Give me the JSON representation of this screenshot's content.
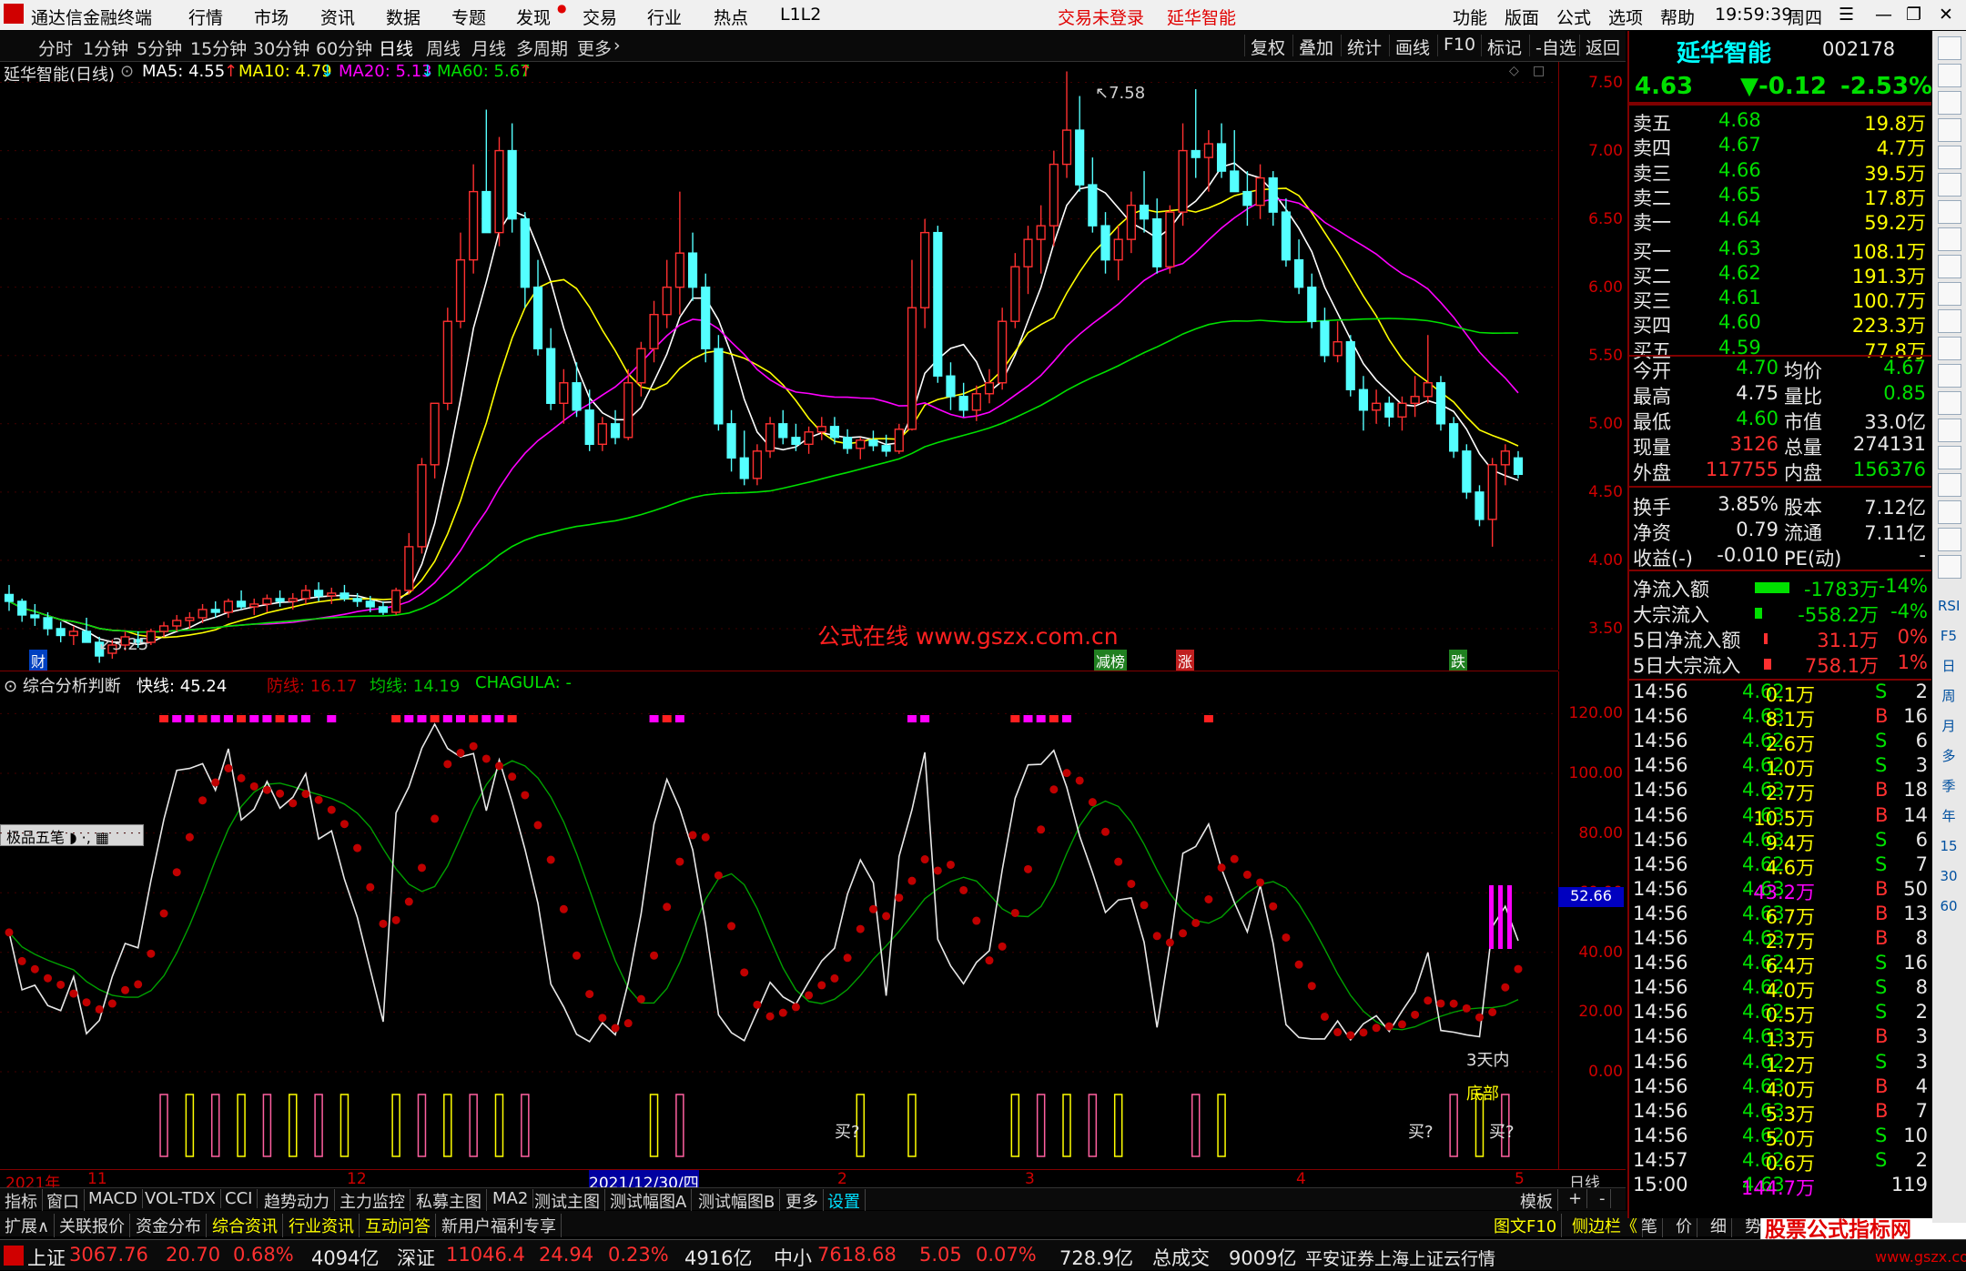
{
  "titlebar": {
    "app_name": "通达信金融终端",
    "menus": [
      "行情",
      "市场",
      "资讯",
      "数据",
      "专题",
      "发现",
      "交易",
      "行业",
      "热点",
      "L1L2"
    ],
    "status_trade": "交易未登录",
    "status_stock": "延华智能",
    "right_menus": [
      "功能",
      "版面",
      "公式",
      "选项",
      "帮助"
    ],
    "clock": "19:59:39",
    "weekday": "周四"
  },
  "periodbar": {
    "periods": [
      "分时",
      "1分钟",
      "5分钟",
      "15分钟",
      "30分钟",
      "60分钟",
      "日线",
      "周线",
      "月线",
      "多周期",
      "更多"
    ],
    "selected": "日线",
    "actions": [
      "复权",
      "叠加",
      "统计",
      "画线",
      "F10",
      "标记",
      "-自选",
      "返回"
    ]
  },
  "kline": {
    "title": "延华智能(日线)",
    "ma5": "MA5: 4.55",
    "ma10": "MA10: 4.79",
    "ma20": "MA20: 5.13",
    "ma60": "MA60: 5.67",
    "high_label": "7.58",
    "low_label": "3.25",
    "watermark": "公式在线  www.gszx.com.cn",
    "markers": [
      "财",
      "减榜",
      "涨",
      "跌"
    ],
    "y_ticks": [
      "7.50",
      "7.00",
      "6.50",
      "6.00",
      "5.50",
      "5.00",
      "4.50",
      "4.00",
      "3.50"
    ]
  },
  "indicator": {
    "title": "综合分析判断",
    "fast_label": "快线: 45.24",
    "defense_label": "防线: 16.17",
    "avg_label": "均线: 14.19",
    "chagula_label": "CHAGULA: -",
    "toolbar_label": "极品五笔",
    "current_value": "52.66",
    "y_ticks": [
      "120.00",
      "100.00",
      "80.00",
      "60.00",
      "40.00",
      "20.00",
      "0.00"
    ],
    "annotations": [
      "3天内",
      "底部",
      "买?",
      "买?",
      "买?"
    ]
  },
  "xaxis": {
    "labels": [
      "2021年",
      "11",
      "12",
      "2021/12/30/四",
      "2",
      "3",
      "4",
      "5"
    ],
    "period": "日线"
  },
  "quote": {
    "name": "延华智能",
    "code": "002178",
    "price": "4.63",
    "change": "▼-0.12",
    "change_pct": "-2.53%",
    "asks": [
      {
        "label": "卖五",
        "price": "4.68",
        "vol": "19.8万"
      },
      {
        "label": "卖四",
        "price": "4.67",
        "vol": "4.7万"
      },
      {
        "label": "卖三",
        "price": "4.66",
        "vol": "39.5万"
      },
      {
        "label": "卖二",
        "price": "4.65",
        "vol": "17.8万"
      },
      {
        "label": "卖一",
        "price": "4.64",
        "vol": "59.2万"
      }
    ],
    "bids": [
      {
        "label": "买一",
        "price": "4.63",
        "vol": "108.1万"
      },
      {
        "label": "买二",
        "price": "4.62",
        "vol": "191.3万"
      },
      {
        "label": "买三",
        "price": "4.61",
        "vol": "100.7万"
      },
      {
        "label": "买四",
        "price": "4.60",
        "vol": "223.3万"
      },
      {
        "label": "买五",
        "price": "4.59",
        "vol": "77.8万"
      }
    ],
    "stats": [
      [
        "今开",
        "4.70",
        "均价",
        "4.67"
      ],
      [
        "最高",
        "4.75",
        "量比",
        "0.85"
      ],
      [
        "最低",
        "4.60",
        "市值",
        "33.0亿"
      ],
      [
        "现量",
        "3126",
        "总量",
        "274131"
      ],
      [
        "外盘",
        "117755",
        "内盘",
        "156376"
      ]
    ],
    "stats2": [
      [
        "换手",
        "3.85%",
        "股本",
        "7.12亿"
      ],
      [
        "净资",
        "0.79",
        "流通",
        "7.11亿"
      ],
      [
        "收益(-)",
        "-0.010",
        "PE(动)",
        "-"
      ]
    ],
    "flows": [
      {
        "label": "净流入额",
        "value": "-1783万",
        "pct": "-14%"
      },
      {
        "label": "大宗流入",
        "value": "-558.2万",
        "pct": "-4%"
      },
      {
        "label": "5日净流入额",
        "value": "31.1万",
        "pct": "0%"
      },
      {
        "label": "5日大宗流入",
        "value": "758.1万",
        "pct": "1%"
      }
    ],
    "ticks": [
      [
        "14:56",
        "4.62",
        "0.1万",
        "S",
        "2"
      ],
      [
        "14:56",
        "4.63",
        "8.1万",
        "B",
        "16"
      ],
      [
        "14:56",
        "4.62",
        "2.6万",
        "S",
        "6"
      ],
      [
        "14:56",
        "4.62",
        "1.0万",
        "S",
        "3"
      ],
      [
        "14:56",
        "4.63",
        "2.7万",
        "B",
        "18"
      ],
      [
        "14:56",
        "4.63",
        "10.5万",
        "B",
        "14"
      ],
      [
        "14:56",
        "4.63",
        "9.4万",
        "S",
        "6"
      ],
      [
        "14:56",
        "4.62",
        "4.6万",
        "S",
        "7"
      ],
      [
        "14:56",
        "4.63",
        "43.2万",
        "B",
        "50"
      ],
      [
        "14:56",
        "4.63",
        "6.7万",
        "B",
        "13"
      ],
      [
        "14:56",
        "4.63",
        "2.7万",
        "B",
        "8"
      ],
      [
        "14:56",
        "4.62",
        "6.4万",
        "S",
        "16"
      ],
      [
        "14:56",
        "4.62",
        "4.0万",
        "S",
        "8"
      ],
      [
        "14:56",
        "4.62",
        "0.5万",
        "S",
        "2"
      ],
      [
        "14:56",
        "4.63",
        "1.3万",
        "B",
        "3"
      ],
      [
        "14:56",
        "4.62",
        "1.2万",
        "S",
        "3"
      ],
      [
        "14:56",
        "4.63",
        "4.0万",
        "B",
        "4"
      ],
      [
        "14:56",
        "4.63",
        "5.3万",
        "B",
        "7"
      ],
      [
        "14:56",
        "4.62",
        "5.0万",
        "S",
        "10"
      ],
      [
        "14:57",
        "4.62",
        "0.6万",
        "S",
        "2"
      ],
      [
        "15:00",
        "4.63",
        "144.7万",
        "",
        "119"
      ]
    ]
  },
  "tabs1": [
    "指标",
    "窗口",
    "MACD",
    "VOL-TDX",
    "CCI",
    "趋势动力",
    "主力监控",
    "私募主图",
    "MA2",
    "测试主图",
    "测试幅图A",
    "测试幅图B",
    "更多",
    "设置",
    "模板",
    "+",
    "-"
  ],
  "tabs2": [
    "扩展∧",
    "关联报价",
    "资金分布",
    "综合资讯",
    "行业资讯",
    "互动问答",
    "新用户福利专享"
  ],
  "tabs2_right": [
    "图文F10",
    "侧边栏《",
    "笔",
    "价",
    "细",
    "势"
  ],
  "ticker": [
    {
      "name": "上证",
      "val": "3067.76",
      "chg": "20.70",
      "pct": "0.68%",
      "amt": "4094亿"
    },
    {
      "name": "深证",
      "val": "11046.4",
      "chg": "24.94",
      "pct": "0.23%",
      "amt": "4916亿"
    },
    {
      "name": "中小",
      "val": "7618.68",
      "chg": "5.05",
      "pct": "0.07%",
      "amt": "728.9亿"
    }
  ],
  "ticker_extra": {
    "label": "总成交",
    "value": "9009亿",
    "broker": "平安证券上海上证云行情"
  },
  "corner_logo": "股票公式指标网",
  "corner_url": "www.gszx.com",
  "sidebar_tools": [
    "RSI",
    "F5",
    "日",
    "周",
    "月",
    "多",
    "季",
    "年",
    "15",
    "30",
    "60"
  ],
  "colors": {
    "up": "#ff3030",
    "down": "#00e000",
    "candle_down": "#54ffff",
    "ma5": "#ffffff",
    "ma10": "#ffff00",
    "ma20": "#ff00ff",
    "ma60": "#00e000"
  },
  "chart_data": {
    "type": "candlestick",
    "candles": [
      [
        3.75,
        3.82,
        3.63,
        3.7
      ],
      [
        3.7,
        3.72,
        3.55,
        3.6
      ],
      [
        3.6,
        3.68,
        3.52,
        3.58
      ],
      [
        3.58,
        3.62,
        3.45,
        3.5
      ],
      [
        3.5,
        3.55,
        3.4,
        3.45
      ],
      [
        3.45,
        3.52,
        3.38,
        3.48
      ],
      [
        3.48,
        3.58,
        3.42,
        3.4
      ],
      [
        3.4,
        3.44,
        3.25,
        3.3
      ],
      [
        3.32,
        3.42,
        3.28,
        3.38
      ],
      [
        3.38,
        3.48,
        3.34,
        3.44
      ],
      [
        3.42,
        3.48,
        3.36,
        3.4
      ],
      [
        3.4,
        3.5,
        3.38,
        3.48
      ],
      [
        3.48,
        3.55,
        3.44,
        3.52
      ],
      [
        3.52,
        3.6,
        3.48,
        3.56
      ],
      [
        3.56,
        3.62,
        3.5,
        3.58
      ],
      [
        3.58,
        3.68,
        3.54,
        3.64
      ],
      [
        3.64,
        3.7,
        3.58,
        3.62
      ],
      [
        3.62,
        3.72,
        3.58,
        3.7
      ],
      [
        3.7,
        3.78,
        3.64,
        3.66
      ],
      [
        3.66,
        3.72,
        3.6,
        3.68
      ],
      [
        3.68,
        3.75,
        3.62,
        3.72
      ],
      [
        3.72,
        3.78,
        3.66,
        3.7
      ],
      [
        3.7,
        3.76,
        3.64,
        3.72
      ],
      [
        3.72,
        3.82,
        3.68,
        3.78
      ],
      [
        3.78,
        3.84,
        3.7,
        3.74
      ],
      [
        3.74,
        3.8,
        3.68,
        3.76
      ],
      [
        3.76,
        3.82,
        3.7,
        3.72
      ],
      [
        3.72,
        3.76,
        3.66,
        3.7
      ],
      [
        3.7,
        3.74,
        3.62,
        3.66
      ],
      [
        3.66,
        3.7,
        3.6,
        3.62
      ],
      [
        3.62,
        3.8,
        3.6,
        3.78
      ],
      [
        3.78,
        4.2,
        3.75,
        4.1
      ],
      [
        4.1,
        4.75,
        4.05,
        4.7
      ],
      [
        4.7,
        5.1,
        4.6,
        5.15
      ],
      [
        5.15,
        5.85,
        5.1,
        5.75
      ],
      [
        5.75,
        6.4,
        5.7,
        6.2
      ],
      [
        6.2,
        6.9,
        6.1,
        6.7
      ],
      [
        6.7,
        7.3,
        6.4,
        6.4
      ],
      [
        6.4,
        7.1,
        6.3,
        7.0
      ],
      [
        7.0,
        7.2,
        6.4,
        6.5
      ],
      [
        6.5,
        6.55,
        5.85,
        6.0
      ],
      [
        6.0,
        6.2,
        5.5,
        5.55
      ],
      [
        5.55,
        5.7,
        5.1,
        5.15
      ],
      [
        5.15,
        5.4,
        5.0,
        5.3
      ],
      [
        5.3,
        5.45,
        5.05,
        5.1
      ],
      [
        5.1,
        5.25,
        4.8,
        4.85
      ],
      [
        4.85,
        5.05,
        4.8,
        5.0
      ],
      [
        5.0,
        5.1,
        4.85,
        4.9
      ],
      [
        4.9,
        5.4,
        4.88,
        5.3
      ],
      [
        5.3,
        5.6,
        5.2,
        5.55
      ],
      [
        5.55,
        5.9,
        5.45,
        5.8
      ],
      [
        5.8,
        6.2,
        5.7,
        6.0
      ],
      [
        6.0,
        6.7,
        5.8,
        6.25
      ],
      [
        6.25,
        6.4,
        5.9,
        6.0
      ],
      [
        6.0,
        6.1,
        5.45,
        5.55
      ],
      [
        5.55,
        5.65,
        4.95,
        5.0
      ],
      [
        5.0,
        5.1,
        4.65,
        4.75
      ],
      [
        4.75,
        4.95,
        4.55,
        4.6
      ],
      [
        4.6,
        4.85,
        4.55,
        4.8
      ],
      [
        4.8,
        5.05,
        4.75,
        5.0
      ],
      [
        5.0,
        5.1,
        4.85,
        4.9
      ],
      [
        4.9,
        5.0,
        4.8,
        4.85
      ],
      [
        4.85,
        4.98,
        4.78,
        4.94
      ],
      [
        4.94,
        5.05,
        4.88,
        4.98
      ],
      [
        4.98,
        5.05,
        4.85,
        4.9
      ],
      [
        4.9,
        4.96,
        4.78,
        4.82
      ],
      [
        4.82,
        4.9,
        4.74,
        4.88
      ],
      [
        4.88,
        4.95,
        4.8,
        4.84
      ],
      [
        4.84,
        4.92,
        4.76,
        4.8
      ],
      [
        4.8,
        5.0,
        4.78,
        4.96
      ],
      [
        4.96,
        6.2,
        4.95,
        5.85
      ],
      [
        5.85,
        6.5,
        5.7,
        6.4
      ],
      [
        6.4,
        6.45,
        5.3,
        5.35
      ],
      [
        5.35,
        5.45,
        5.1,
        5.2
      ],
      [
        5.2,
        5.3,
        5.05,
        5.1
      ],
      [
        5.1,
        5.28,
        5.02,
        5.22
      ],
      [
        5.22,
        5.4,
        5.15,
        5.3
      ],
      [
        5.3,
        5.85,
        5.25,
        5.75
      ],
      [
        5.75,
        6.25,
        5.7,
        6.15
      ],
      [
        6.15,
        6.45,
        5.95,
        6.35
      ],
      [
        6.35,
        6.6,
        6.1,
        6.45
      ],
      [
        6.45,
        7.0,
        6.3,
        6.9
      ],
      [
        6.9,
        7.58,
        6.8,
        7.15
      ],
      [
        7.15,
        7.4,
        6.7,
        6.75
      ],
      [
        6.75,
        6.95,
        6.4,
        6.45
      ],
      [
        6.45,
        6.55,
        6.1,
        6.2
      ],
      [
        6.2,
        6.45,
        6.05,
        6.35
      ],
      [
        6.35,
        6.7,
        6.25,
        6.6
      ],
      [
        6.6,
        6.85,
        6.4,
        6.5
      ],
      [
        6.5,
        6.65,
        6.1,
        6.15
      ],
      [
        6.15,
        6.6,
        6.1,
        6.55
      ],
      [
        6.55,
        7.2,
        6.45,
        7.0
      ],
      [
        7.0,
        7.45,
        6.8,
        6.95
      ],
      [
        6.95,
        7.15,
        6.7,
        7.05
      ],
      [
        7.05,
        7.2,
        6.8,
        6.85
      ],
      [
        6.85,
        7.15,
        6.75,
        6.7
      ],
      [
        6.7,
        6.85,
        6.45,
        6.6
      ],
      [
        6.6,
        6.9,
        6.5,
        6.8
      ],
      [
        6.8,
        6.85,
        6.45,
        6.55
      ],
      [
        6.55,
        6.65,
        6.15,
        6.2
      ],
      [
        6.2,
        6.35,
        5.95,
        6.0
      ],
      [
        6.0,
        6.1,
        5.7,
        5.75
      ],
      [
        5.75,
        5.85,
        5.45,
        5.5
      ],
      [
        5.5,
        5.75,
        5.45,
        5.6
      ],
      [
        5.6,
        5.65,
        5.2,
        5.25
      ],
      [
        5.25,
        5.35,
        4.95,
        5.1
      ],
      [
        5.1,
        5.25,
        5.0,
        5.15
      ],
      [
        5.15,
        5.2,
        4.98,
        5.05
      ],
      [
        5.05,
        5.2,
        4.95,
        5.15
      ],
      [
        5.15,
        5.35,
        5.05,
        5.2
      ],
      [
        5.2,
        5.65,
        5.15,
        5.3
      ],
      [
        5.3,
        5.35,
        4.95,
        5.0
      ],
      [
        5.0,
        5.05,
        4.75,
        4.8
      ],
      [
        4.8,
        4.85,
        4.45,
        4.5
      ],
      [
        4.5,
        4.55,
        4.25,
        4.3
      ],
      [
        4.3,
        4.75,
        4.1,
        4.7
      ],
      [
        4.7,
        4.85,
        4.55,
        4.8
      ],
      [
        4.75,
        4.8,
        4.6,
        4.63
      ]
    ],
    "ma_labels": [
      "MA5",
      "MA10",
      "MA20",
      "MA60"
    ],
    "ylim": [
      3.2,
      7.65
    ]
  }
}
